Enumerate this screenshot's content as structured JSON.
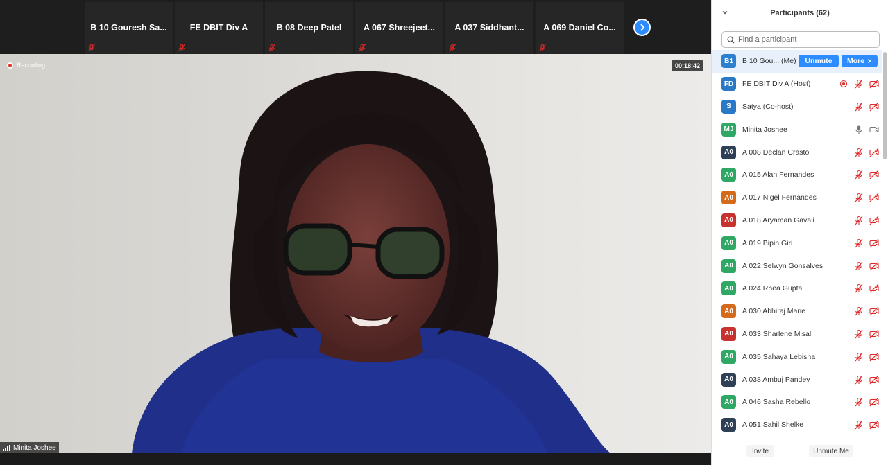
{
  "strip": {
    "tiles": [
      {
        "name": "B 10 Gouresh Sa..."
      },
      {
        "name": "FE DBIT Div A"
      },
      {
        "name": "B 08 Deep Patel"
      },
      {
        "name": "A 067 Shreejeet..."
      },
      {
        "name": "A 037 Siddhant..."
      },
      {
        "name": "A 069 Daniel Co..."
      }
    ],
    "next_icon": "chevron-right-icon"
  },
  "video": {
    "recording_label": "Recording",
    "timer": "00:18:42",
    "speaker_name": "Minita Joshee"
  },
  "panel": {
    "title": "Participants (62)",
    "search_placeholder": "Find a participant",
    "unmute_label": "Unmute",
    "more_label": "More",
    "invite_label": "Invite",
    "unmute_me_label": "Unmute Me",
    "participants": [
      {
        "initials": "B1",
        "name": "B 10 Gou...  (Me)",
        "color": "#2d7fd0",
        "me": true
      },
      {
        "initials": "FD",
        "name": "FE DBIT Div A (Host)",
        "color": "#2a79c6",
        "recording": true
      },
      {
        "initials": "S",
        "name": "Satya (Co-host)",
        "color": "#2a79c6"
      },
      {
        "initials": "MJ",
        "name": "Minita Joshee",
        "color": "#2ea864",
        "active": true
      },
      {
        "initials": "A0",
        "name": "A 008 Declan Crasto",
        "color": "#2e3f56"
      },
      {
        "initials": "A0",
        "name": "A 015 Alan Fernandes",
        "color": "#2ea864"
      },
      {
        "initials": "A0",
        "name": "A 017 Nigel Fernandes",
        "color": "#d46a1c"
      },
      {
        "initials": "A0",
        "name": "A 018 Aryaman Gavali",
        "color": "#c7322e"
      },
      {
        "initials": "A0",
        "name": "A 019 Bipin Giri",
        "color": "#2ea864"
      },
      {
        "initials": "A0",
        "name": "A 022 Selwyn Gonsalves",
        "color": "#2ea864"
      },
      {
        "initials": "A0",
        "name": "A 024 Rhea Gupta",
        "color": "#2ea864"
      },
      {
        "initials": "A0",
        "name": "A 030 Abhiraj Mane",
        "color": "#d46a1c"
      },
      {
        "initials": "A0",
        "name": "A 033 Sharlene Misal",
        "color": "#c7322e"
      },
      {
        "initials": "A0",
        "name": "A 035 Sahaya Lebisha",
        "color": "#2ea864"
      },
      {
        "initials": "A0",
        "name": "A 038 Ambuj Pandey",
        "color": "#2e3f56"
      },
      {
        "initials": "A0",
        "name": "A 046 Sasha Rebello",
        "color": "#2ea864"
      },
      {
        "initials": "A0",
        "name": "A 051 Sahil Shelke",
        "color": "#2e3f56"
      }
    ]
  },
  "colors": {
    "accent": "#2d8cff",
    "muted_red": "#e02828"
  }
}
